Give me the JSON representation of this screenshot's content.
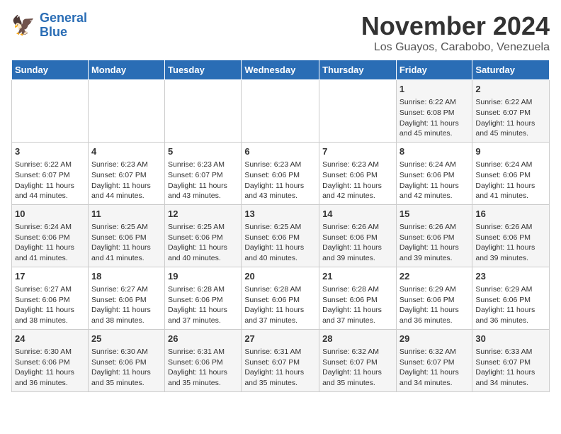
{
  "logo": {
    "line1": "General",
    "line2": "Blue"
  },
  "title": "November 2024",
  "subtitle": "Los Guayos, Carabobo, Venezuela",
  "weekdays": [
    "Sunday",
    "Monday",
    "Tuesday",
    "Wednesday",
    "Thursday",
    "Friday",
    "Saturday"
  ],
  "weeks": [
    [
      {
        "day": "",
        "info": ""
      },
      {
        "day": "",
        "info": ""
      },
      {
        "day": "",
        "info": ""
      },
      {
        "day": "",
        "info": ""
      },
      {
        "day": "",
        "info": ""
      },
      {
        "day": "1",
        "info": "Sunrise: 6:22 AM\nSunset: 6:08 PM\nDaylight: 11 hours and 45 minutes."
      },
      {
        "day": "2",
        "info": "Sunrise: 6:22 AM\nSunset: 6:07 PM\nDaylight: 11 hours and 45 minutes."
      }
    ],
    [
      {
        "day": "3",
        "info": "Sunrise: 6:22 AM\nSunset: 6:07 PM\nDaylight: 11 hours and 44 minutes."
      },
      {
        "day": "4",
        "info": "Sunrise: 6:23 AM\nSunset: 6:07 PM\nDaylight: 11 hours and 44 minutes."
      },
      {
        "day": "5",
        "info": "Sunrise: 6:23 AM\nSunset: 6:07 PM\nDaylight: 11 hours and 43 minutes."
      },
      {
        "day": "6",
        "info": "Sunrise: 6:23 AM\nSunset: 6:06 PM\nDaylight: 11 hours and 43 minutes."
      },
      {
        "day": "7",
        "info": "Sunrise: 6:23 AM\nSunset: 6:06 PM\nDaylight: 11 hours and 42 minutes."
      },
      {
        "day": "8",
        "info": "Sunrise: 6:24 AM\nSunset: 6:06 PM\nDaylight: 11 hours and 42 minutes."
      },
      {
        "day": "9",
        "info": "Sunrise: 6:24 AM\nSunset: 6:06 PM\nDaylight: 11 hours and 41 minutes."
      }
    ],
    [
      {
        "day": "10",
        "info": "Sunrise: 6:24 AM\nSunset: 6:06 PM\nDaylight: 11 hours and 41 minutes."
      },
      {
        "day": "11",
        "info": "Sunrise: 6:25 AM\nSunset: 6:06 PM\nDaylight: 11 hours and 41 minutes."
      },
      {
        "day": "12",
        "info": "Sunrise: 6:25 AM\nSunset: 6:06 PM\nDaylight: 11 hours and 40 minutes."
      },
      {
        "day": "13",
        "info": "Sunrise: 6:25 AM\nSunset: 6:06 PM\nDaylight: 11 hours and 40 minutes."
      },
      {
        "day": "14",
        "info": "Sunrise: 6:26 AM\nSunset: 6:06 PM\nDaylight: 11 hours and 39 minutes."
      },
      {
        "day": "15",
        "info": "Sunrise: 6:26 AM\nSunset: 6:06 PM\nDaylight: 11 hours and 39 minutes."
      },
      {
        "day": "16",
        "info": "Sunrise: 6:26 AM\nSunset: 6:06 PM\nDaylight: 11 hours and 39 minutes."
      }
    ],
    [
      {
        "day": "17",
        "info": "Sunrise: 6:27 AM\nSunset: 6:06 PM\nDaylight: 11 hours and 38 minutes."
      },
      {
        "day": "18",
        "info": "Sunrise: 6:27 AM\nSunset: 6:06 PM\nDaylight: 11 hours and 38 minutes."
      },
      {
        "day": "19",
        "info": "Sunrise: 6:28 AM\nSunset: 6:06 PM\nDaylight: 11 hours and 37 minutes."
      },
      {
        "day": "20",
        "info": "Sunrise: 6:28 AM\nSunset: 6:06 PM\nDaylight: 11 hours and 37 minutes."
      },
      {
        "day": "21",
        "info": "Sunrise: 6:28 AM\nSunset: 6:06 PM\nDaylight: 11 hours and 37 minutes."
      },
      {
        "day": "22",
        "info": "Sunrise: 6:29 AM\nSunset: 6:06 PM\nDaylight: 11 hours and 36 minutes."
      },
      {
        "day": "23",
        "info": "Sunrise: 6:29 AM\nSunset: 6:06 PM\nDaylight: 11 hours and 36 minutes."
      }
    ],
    [
      {
        "day": "24",
        "info": "Sunrise: 6:30 AM\nSunset: 6:06 PM\nDaylight: 11 hours and 36 minutes."
      },
      {
        "day": "25",
        "info": "Sunrise: 6:30 AM\nSunset: 6:06 PM\nDaylight: 11 hours and 35 minutes."
      },
      {
        "day": "26",
        "info": "Sunrise: 6:31 AM\nSunset: 6:06 PM\nDaylight: 11 hours and 35 minutes."
      },
      {
        "day": "27",
        "info": "Sunrise: 6:31 AM\nSunset: 6:07 PM\nDaylight: 11 hours and 35 minutes."
      },
      {
        "day": "28",
        "info": "Sunrise: 6:32 AM\nSunset: 6:07 PM\nDaylight: 11 hours and 35 minutes."
      },
      {
        "day": "29",
        "info": "Sunrise: 6:32 AM\nSunset: 6:07 PM\nDaylight: 11 hours and 34 minutes."
      },
      {
        "day": "30",
        "info": "Sunrise: 6:33 AM\nSunset: 6:07 PM\nDaylight: 11 hours and 34 minutes."
      }
    ]
  ]
}
